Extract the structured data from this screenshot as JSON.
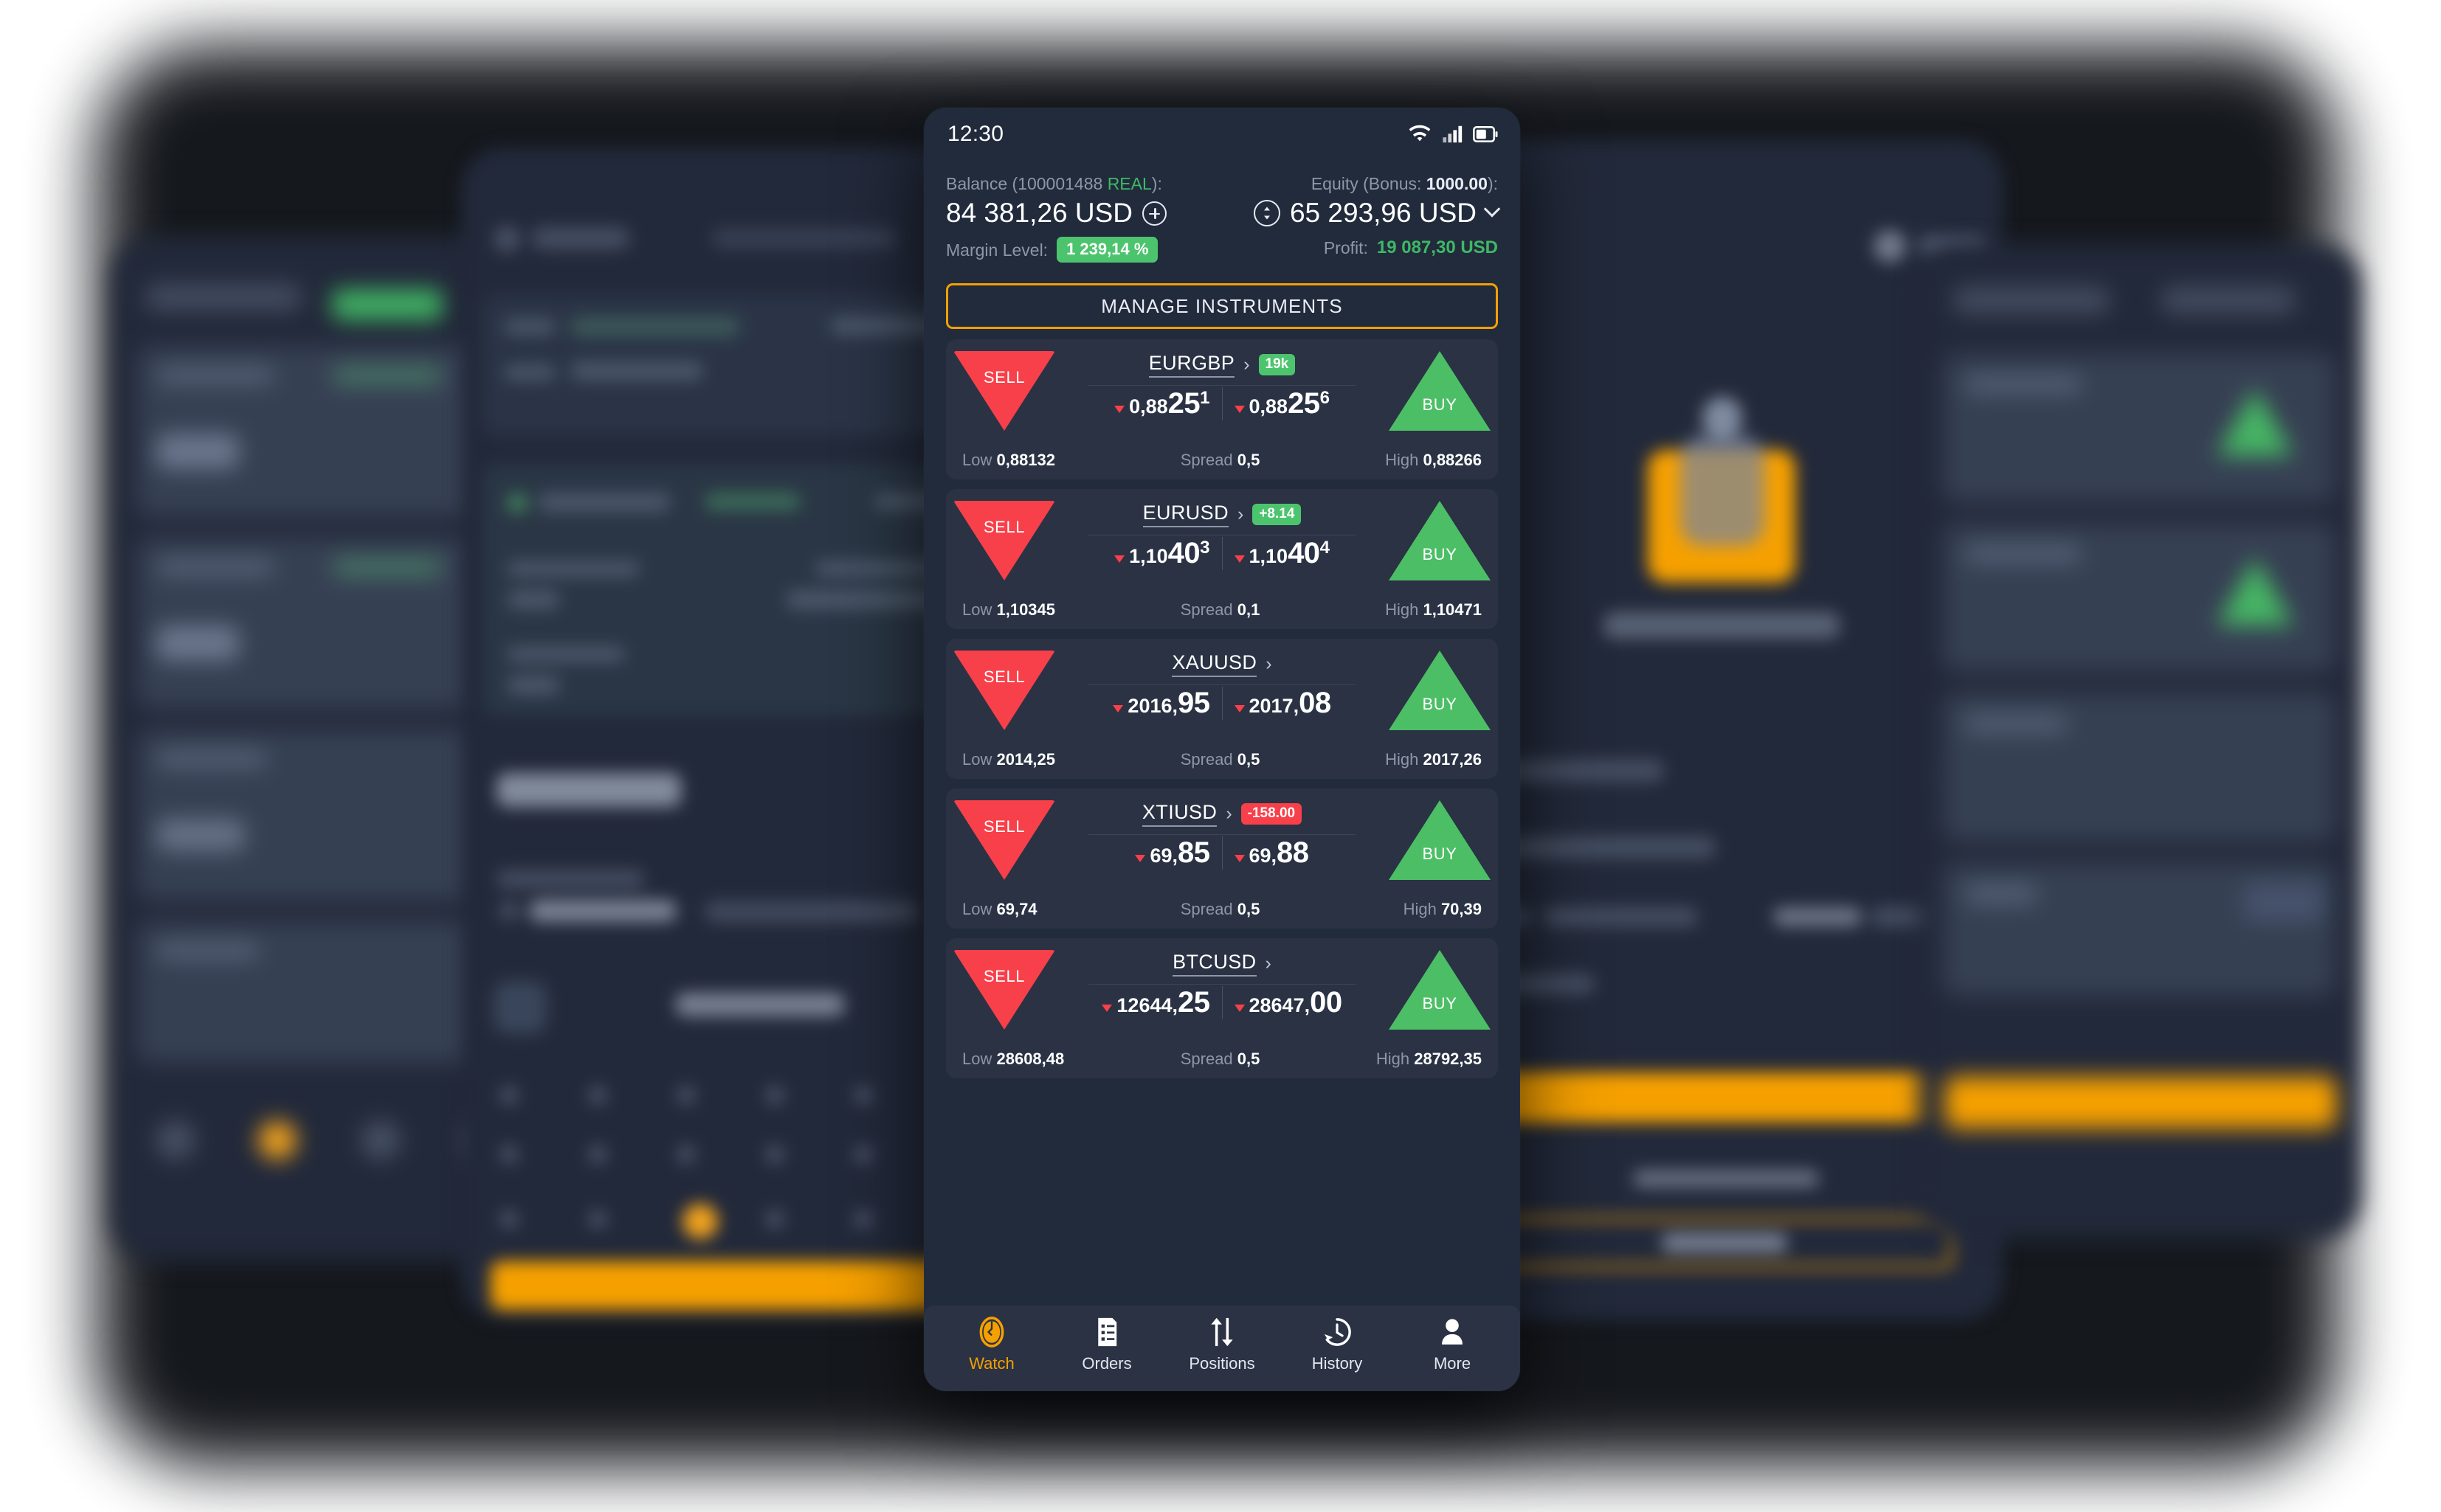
{
  "statusbar": {
    "time": "12:30",
    "icons": [
      "wifi-icon",
      "signal-icon",
      "battery-icon"
    ]
  },
  "account": {
    "balance_label_pre": "Balance (100001488 ",
    "balance_label_real": "REAL",
    "balance_label_post": "):",
    "balance_value": "84 381,26 USD",
    "add_funds_icon": "plus-circle-icon",
    "equity_label_pre": "Equity (Bonus: ",
    "equity_label_bonus": "1000.00",
    "equity_label_post": "):",
    "equity_value": "65 293,96 USD",
    "equity_icon": "updown-arrows-circle-icon",
    "equity_chevron": "chevron-down-icon",
    "margin_label": "Margin Level:",
    "margin_value": "1 239,14 %",
    "profit_label": "Profit:",
    "profit_value": "19 087,30 USD"
  },
  "manage_instruments_label": "MANAGE INSTRUMENTS",
  "labels": {
    "sell": "SELL",
    "buy": "BUY",
    "low": "Low",
    "spread": "Spread",
    "high": "High",
    "chevron": "›"
  },
  "instruments": [
    {
      "symbol": "EURGBP",
      "badge": "19k",
      "badge_type": "pos",
      "sell": {
        "small": "0,88",
        "big": "25",
        "sup": "1"
      },
      "buy": {
        "small": "0,88",
        "big": "25",
        "sup": "6"
      },
      "low": "0,88132",
      "spread": "0,5",
      "high": "0,88266"
    },
    {
      "symbol": "EURUSD",
      "badge": "+8.14",
      "badge_type": "pos",
      "sell": {
        "small": "1,10",
        "big": "40",
        "sup": "3"
      },
      "buy": {
        "small": "1,10",
        "big": "40",
        "sup": "4"
      },
      "low": "1,10345",
      "spread": "0,1",
      "high": "1,10471"
    },
    {
      "symbol": "XAUUSD",
      "badge": "",
      "badge_type": "none",
      "sell": {
        "small": "2016,",
        "big": "95",
        "sup": ""
      },
      "buy": {
        "small": "2017,",
        "big": "08",
        "sup": ""
      },
      "low": "2014,25",
      "spread": "0,5",
      "high": "2017,26"
    },
    {
      "symbol": "XTIUSD",
      "badge": "-158.00",
      "badge_type": "neg",
      "sell": {
        "small": "69,",
        "big": "85",
        "sup": ""
      },
      "buy": {
        "small": "69,",
        "big": "88",
        "sup": ""
      },
      "low": "69,74",
      "spread": "0,5",
      "high": "70,39"
    },
    {
      "symbol": "BTCUSD",
      "badge": "",
      "badge_type": "none",
      "sell": {
        "small": "12644,",
        "big": "25",
        "sup": ""
      },
      "buy": {
        "small": "28647,",
        "big": "00",
        "sup": ""
      },
      "low": "28608,48",
      "spread": "0,5",
      "high": "28792,35"
    }
  ],
  "bottom_nav": [
    {
      "label": "Watch",
      "icon": "watch-coin-icon",
      "active": true
    },
    {
      "label": "Orders",
      "icon": "orders-list-icon",
      "active": false
    },
    {
      "label": "Positions",
      "icon": "up-down-arrows-icon",
      "active": false
    },
    {
      "label": "History",
      "icon": "clock-history-icon",
      "active": false
    },
    {
      "label": "More",
      "icon": "person-icon",
      "active": false
    }
  ],
  "colors": {
    "accent_orange": "#f5a000",
    "buy_green": "#4cbf66",
    "sell_red": "#f8404a",
    "profit_green": "#3fb866",
    "card_bg": "#2a3244",
    "screen_bg": "#222b3c"
  }
}
